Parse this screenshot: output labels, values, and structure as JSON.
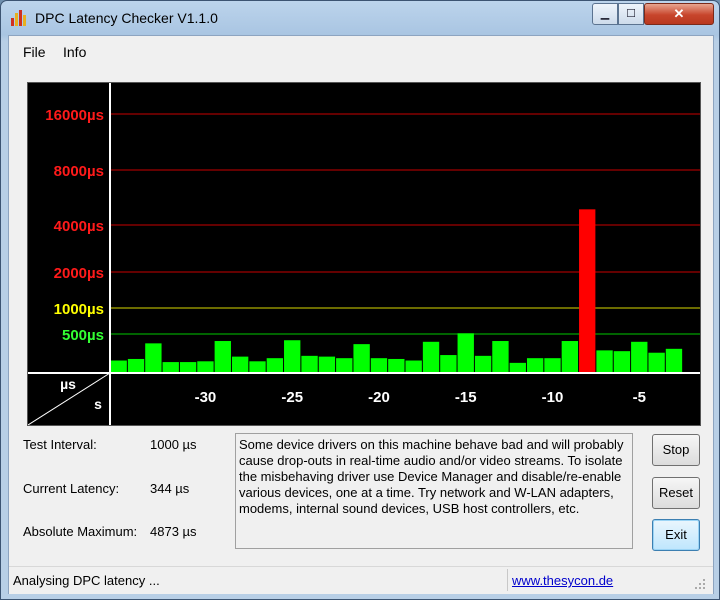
{
  "window": {
    "title": "DPC Latency Checker V1.1.0"
  },
  "titlebar_buttons": {
    "minimize": "▁",
    "maximize": "☐",
    "close": "✕"
  },
  "menu": [
    "File",
    "Info"
  ],
  "graph": {
    "y_labels": [
      {
        "label": "16000µs",
        "value": 16000,
        "color": "#ff1a1a"
      },
      {
        "label": "8000µs",
        "value": 8000,
        "color": "#ff1a1a"
      },
      {
        "label": "4000µs",
        "value": 4000,
        "color": "#ff1a1a"
      },
      {
        "label": "2000µs",
        "value": 2000,
        "color": "#ff1a1a"
      },
      {
        "label": "1000µs",
        "value": 1000,
        "color": "#ffff00"
      },
      {
        "label": "500µs",
        "value": 500,
        "color": "#33ff33"
      }
    ],
    "corner_y": "µs",
    "corner_x": "s",
    "x_labels": [
      {
        "label": "-30",
        "value": -30
      },
      {
        "label": "-25",
        "value": -25
      },
      {
        "label": "-20",
        "value": -20
      },
      {
        "label": "-15",
        "value": -15
      },
      {
        "label": "-10",
        "value": -10
      },
      {
        "label": "-5",
        "value": -5
      }
    ],
    "bar_colors": {
      "ok": "#00ff00",
      "bad": "#ff0000"
    },
    "line_colors": {
      "red": "#c80000",
      "yellow": "#d8d800",
      "green": "#00c800"
    }
  },
  "chart_data": {
    "type": "bar",
    "title": "",
    "xlabel": "s",
    "ylabel": "µs",
    "x": [
      -35,
      -34,
      -33,
      -32,
      -31,
      -30,
      -29,
      -28,
      -27,
      -26,
      -25,
      -24,
      -23,
      -22,
      -21,
      -20,
      -19,
      -18,
      -17,
      -16,
      -15,
      -14,
      -13,
      -12,
      -11,
      -10,
      -9,
      -8,
      -7,
      -6,
      -5,
      -4,
      -3,
      -2,
      -1
    ],
    "values": [
      160,
      180,
      380,
      140,
      140,
      150,
      410,
      210,
      150,
      190,
      420,
      220,
      210,
      190,
      370,
      190,
      180,
      160,
      400,
      230,
      510,
      220,
      410,
      130,
      190,
      190,
      410,
      4873,
      290,
      280,
      400,
      260,
      310
    ],
    "ylim_labels": [
      500,
      1000,
      2000,
      4000,
      8000,
      16000
    ]
  },
  "stats": {
    "test_interval_label": "Test Interval:",
    "test_interval_value": "1000 µs",
    "current_latency_label": "Current Latency:",
    "current_latency_value": "344 µs",
    "absolute_max_label": "Absolute Maximum:",
    "absolute_max_value": "4873 µs"
  },
  "message": "Some device drivers on this machine behave bad and will probably cause drop-outs in real-time audio and/or video streams. To isolate the misbehaving driver use Device Manager and disable/re-enable various devices, one at a time. Try network and W-LAN adapters, modems, internal sound devices, USB host controllers, etc.",
  "buttons": {
    "stop": "Stop",
    "reset": "Reset",
    "exit": "Exit"
  },
  "status": {
    "text": "Analysing DPC latency ...",
    "link": "www.thesycon.de"
  }
}
